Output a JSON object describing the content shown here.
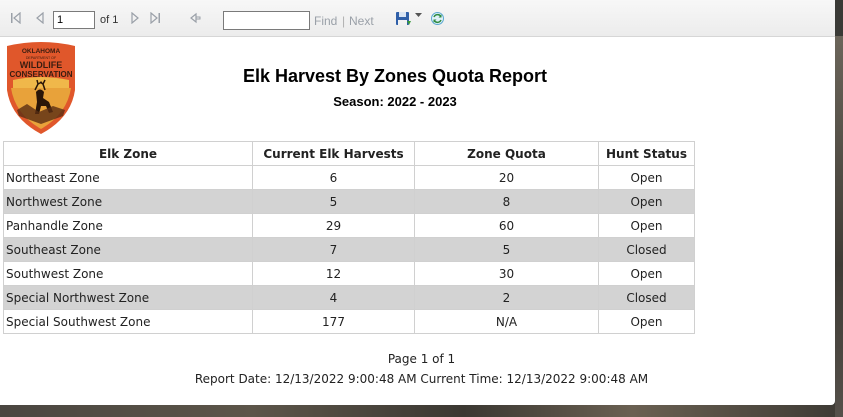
{
  "toolbar": {
    "page_value": "1",
    "page_of": "of 1",
    "find_placeholder": "",
    "find_label": "Find",
    "separator": "|",
    "next_label": "Next",
    "icons": [
      "first-page-icon",
      "previous-page-icon",
      "next-page-icon",
      "last-page-icon",
      "back-icon",
      "save-icon",
      "dropdown-icon",
      "refresh-icon"
    ]
  },
  "logo": {
    "line1": "OKLAHOMA",
    "line2": "DEPARTMENT OF",
    "line3": "WILDLIFE",
    "line4": "CONSERVATION"
  },
  "report": {
    "title": "Elk Harvest By Zones Quota Report",
    "season": "Season: 2022 - 2023",
    "columns": [
      "Elk Zone",
      "Current Elk Harvests",
      "Zone Quota",
      "Hunt Status"
    ],
    "rows": [
      {
        "zone": "Northeast Zone",
        "harvests": "6",
        "quota": "20",
        "status": "Open"
      },
      {
        "zone": "Northwest Zone",
        "harvests": "5",
        "quota": "8",
        "status": "Open"
      },
      {
        "zone": "Panhandle Zone",
        "harvests": "29",
        "quota": "60",
        "status": "Open"
      },
      {
        "zone": "Southeast Zone",
        "harvests": "7",
        "quota": "5",
        "status": "Closed"
      },
      {
        "zone": "Southwest Zone",
        "harvests": "12",
        "quota": "30",
        "status": "Open"
      },
      {
        "zone": "Special Northwest Zone",
        "harvests": "4",
        "quota": "2",
        "status": "Closed"
      },
      {
        "zone": "Special Southwest Zone",
        "harvests": "177",
        "quota": "N/A",
        "status": "Open"
      }
    ],
    "page_footer": "Page 1 of 1",
    "date_footer": "Report Date: 12/13/2022 9:00:48 AM Current Time: 12/13/2022 9:00:48 AM"
  },
  "colors": {
    "row_shade": "#d3d3d3",
    "logo_orange": "#e0572b",
    "logo_gold": "#e8a23a",
    "toolbar_icon": "#9aa0a8"
  }
}
